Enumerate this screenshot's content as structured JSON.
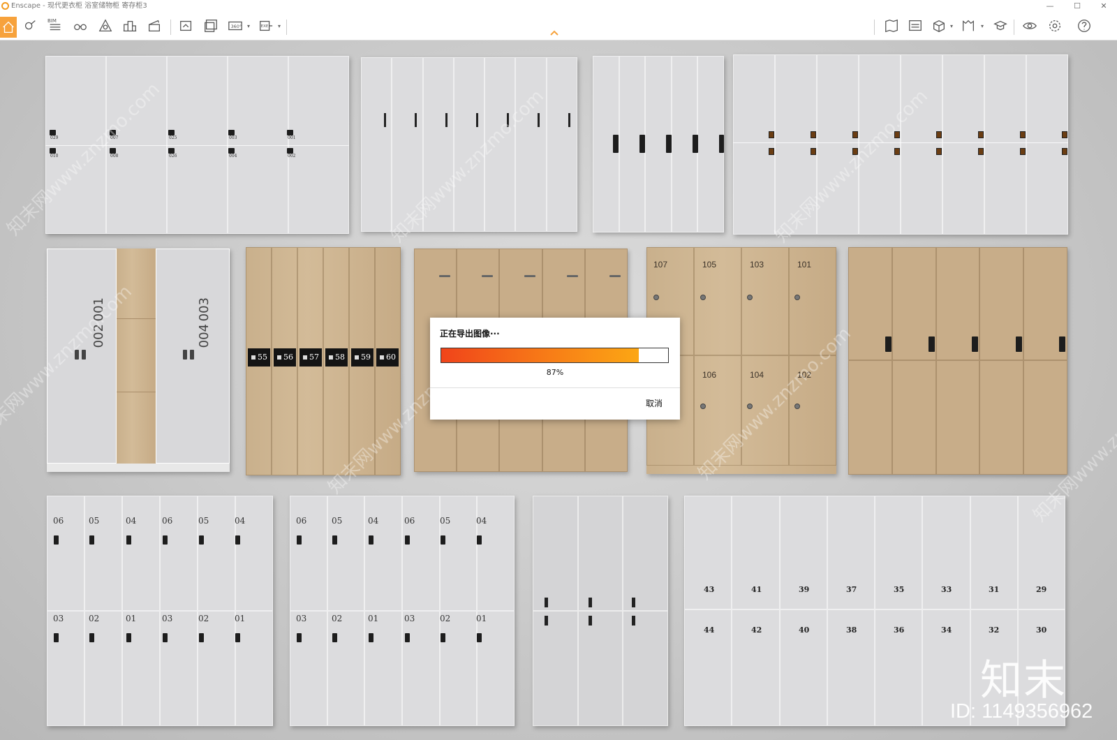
{
  "window": {
    "app_name": "Enscape",
    "title": "Enscape - 现代更衣柜 浴室储物柜 寄存柜3",
    "controls": [
      "—",
      "☐",
      "✕"
    ]
  },
  "toolbar": {
    "bim_label": "BIM",
    "left_tools": [
      "home-icon",
      "asset-icon",
      "bim-icon",
      "binoculars-icon",
      "atlas-icon",
      "buildings-icon",
      "clapper-icon",
      "export-image-icon",
      "batch-export-icon",
      "panorama-360-icon",
      "exe-export-icon"
    ],
    "right_tools": [
      "map-icon",
      "view-icon",
      "box-icon",
      "library-icon",
      "cap-icon",
      "eye-icon",
      "settings-icon",
      "help-icon"
    ],
    "panorama_label": "360°",
    "exe_label": "EXE"
  },
  "dialog": {
    "title": "正在导出图像···",
    "progress": 0.87,
    "progress_text": "87%",
    "cancel_label": "取消"
  },
  "cabinets": {
    "c1_labels": [
      "029",
      "007",
      "025",
      "003",
      "001",
      "010",
      "008",
      "026",
      "004",
      "002"
    ],
    "c6_plates": [
      "55",
      "56",
      "57",
      "58",
      "59",
      "60"
    ],
    "c5_top": "001",
    "c5_mid": "002",
    "c5_top2": "003",
    "c5_mid2": "004",
    "c8_top": [
      "107",
      "105",
      "103",
      "101"
    ],
    "c8_bottom": [
      "106",
      "104",
      "102"
    ],
    "c10_top": [
      "06",
      "05",
      "04",
      "06",
      "05",
      "04"
    ],
    "c10_bottom": [
      "03",
      "02",
      "01",
      "03",
      "02",
      "01"
    ],
    "c13_top": [
      "43",
      "41",
      "39",
      "37",
      "35",
      "33",
      "31",
      "29"
    ],
    "c13_bottom": [
      "44",
      "42",
      "40",
      "38",
      "36",
      "34",
      "32",
      "30"
    ]
  },
  "watermark": {
    "text": "知末网www.znzmo.com",
    "brand": "知末",
    "id_text": "ID: 1149356962"
  },
  "colors": {
    "accent": "#f7a23c",
    "progress_start": "#f0441a",
    "progress_end": "#fca714"
  }
}
